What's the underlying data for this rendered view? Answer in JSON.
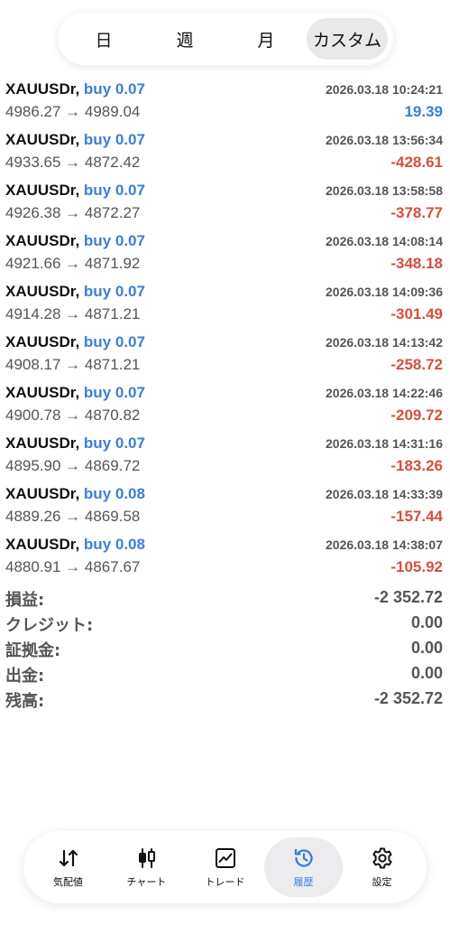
{
  "periods": [
    {
      "label": "日"
    },
    {
      "label": "週"
    },
    {
      "label": "月"
    },
    {
      "label": "カスタム"
    }
  ],
  "deals": [
    {
      "symbol": "XAUUSDr,",
      "side": "buy 0.07",
      "time": "2026.03.18 10:24:21",
      "prices": "4986.27 → 4989.04",
      "profit": "19.39"
    },
    {
      "symbol": "XAUUSDr,",
      "side": "buy 0.07",
      "time": "2026.03.18 13:56:34",
      "prices": "4933.65 → 4872.42",
      "profit": "-428.61"
    },
    {
      "symbol": "XAUUSDr,",
      "side": "buy 0.07",
      "time": "2026.03.18 13:58:58",
      "prices": "4926.38 → 4872.27",
      "profit": "-378.77"
    },
    {
      "symbol": "XAUUSDr,",
      "side": "buy 0.07",
      "time": "2026.03.18 14:08:14",
      "prices": "4921.66 → 4871.92",
      "profit": "-348.18"
    },
    {
      "symbol": "XAUUSDr,",
      "side": "buy 0.07",
      "time": "2026.03.18 14:09:36",
      "prices": "4914.28 → 4871.21",
      "profit": "-301.49"
    },
    {
      "symbol": "XAUUSDr,",
      "side": "buy 0.07",
      "time": "2026.03.18 14:13:42",
      "prices": "4908.17 → 4871.21",
      "profit": "-258.72"
    },
    {
      "symbol": "XAUUSDr,",
      "side": "buy 0.07",
      "time": "2026.03.18 14:22:46",
      "prices": "4900.78 → 4870.82",
      "profit": "-209.72"
    },
    {
      "symbol": "XAUUSDr,",
      "side": "buy 0.07",
      "time": "2026.03.18 14:31:16",
      "prices": "4895.90 → 4869.72",
      "profit": "-183.26"
    },
    {
      "symbol": "XAUUSDr,",
      "side": "buy 0.08",
      "time": "2026.03.18 14:33:39",
      "prices": "4889.26 → 4869.58",
      "profit": "-157.44"
    },
    {
      "symbol": "XAUUSDr,",
      "side": "buy 0.08",
      "time": "2026.03.18 14:38:07",
      "prices": "4880.91 → 4867.67",
      "profit": "-105.92"
    }
  ],
  "summary": [
    {
      "label": "損益:",
      "value": "-2 352.72"
    },
    {
      "label": "クレジット:",
      "value": "0.00"
    },
    {
      "label": "証拠金:",
      "value": "0.00"
    },
    {
      "label": "出金:",
      "value": "0.00"
    },
    {
      "label": "残高:",
      "value": "-2 352.72"
    }
  ],
  "nav": [
    {
      "label": "気配値",
      "icon": "quotes-arrows-icon"
    },
    {
      "label": "チャート",
      "icon": "candlestick-icon"
    },
    {
      "label": "トレード",
      "icon": "trade-chart-icon"
    },
    {
      "label": "履歴",
      "icon": "history-clock-icon"
    },
    {
      "label": "設定",
      "icon": "settings-gear-icon"
    }
  ],
  "colors": {
    "positive": "#3a7fd6",
    "negative": "#d4503e",
    "active_nav": "#3a7fd6"
  }
}
